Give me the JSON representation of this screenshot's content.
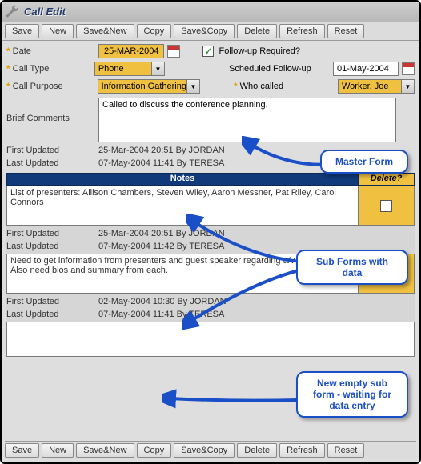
{
  "window": {
    "title": "Call Edit"
  },
  "toolbar": {
    "save": "Save",
    "new": "New",
    "save_new": "Save&New",
    "copy": "Copy",
    "save_copy": "Save&Copy",
    "delete": "Delete",
    "refresh": "Refresh",
    "reset": "Reset"
  },
  "master": {
    "date_label": "Date",
    "date_value": "25-MAR-2004",
    "call_type_label": "Call Type",
    "call_type_value": "Phone",
    "call_purpose_label": "Call Purpose",
    "call_purpose_value": "Information Gathering",
    "followup_req_label": "Follow-up Required?",
    "followup_req_checked": "✓",
    "sched_followup_label": "Scheduled Follow-up",
    "sched_followup_value": "01-May-2004",
    "who_called_label": "Who called",
    "who_called_value": "Worker, Joe",
    "brief_label": "Brief Comments",
    "brief_value": "Called to discuss the conference planning.",
    "first_updated_label": "First Updated",
    "first_updated_value": "25-Mar-2004 20:51  By  JORDAN",
    "last_updated_label": "Last Updated",
    "last_updated_value": "07-May-2004 11:41  By  TERESA"
  },
  "section": {
    "notes": "Notes",
    "delete": "Delete?"
  },
  "subforms": [
    {
      "note": "List of presenters: Allison Chambers, Steven Wiley, Aaron Messner, Pat Riley, Carol Connors",
      "first": "25-Mar-2004 20:51  By  JORDAN",
      "last": "07-May-2004 11:42  By  TERESA"
    },
    {
      "note": "Need to get information from presenters and guest speaker regarding a/v requirements. Also need bios and summary from each.",
      "first": "02-May-2004 10:30  By  JORDAN",
      "last": "07-May-2004 11:41  By  TERESA"
    }
  ],
  "callouts": {
    "master": "Master Form",
    "subs": "Sub Forms with data",
    "empty": "New empty sub form - waiting for data entry"
  }
}
